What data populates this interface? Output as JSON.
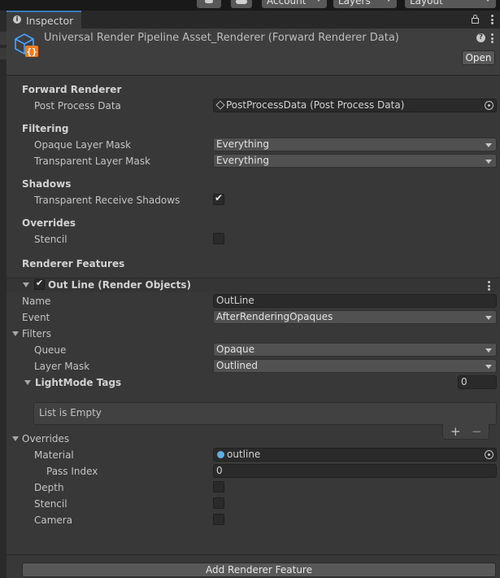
{
  "toolbar": {
    "account": "Account",
    "layers": "Layers",
    "layout": "Layout"
  },
  "tab": {
    "label": "Inspector"
  },
  "header": {
    "title": "Universal Render Pipeline Asset_Renderer (Forward Renderer Data)",
    "open_label": "Open"
  },
  "forward_renderer": {
    "heading": "Forward Renderer",
    "post_process_label": "Post Process Data",
    "post_process_value": "PostProcessData (Post Process Data)"
  },
  "filtering": {
    "heading": "Filtering",
    "opaque_label": "Opaque Layer Mask",
    "opaque_value": "Everything",
    "transparent_label": "Transparent Layer Mask",
    "transparent_value": "Everything"
  },
  "shadows": {
    "heading": "Shadows",
    "receive_label": "Transparent Receive Shadows",
    "receive_checked": true
  },
  "overrides": {
    "heading": "Overrides",
    "stencil_label": "Stencil",
    "stencil_checked": false
  },
  "renderer_features": {
    "heading": "Renderer Features",
    "feature": {
      "title": "Out Line (Render Objects)",
      "enabled": true,
      "name_label": "Name",
      "name_value": "OutLine",
      "event_label": "Event",
      "event_value": "AfterRenderingOpaques",
      "filters_heading": "Filters",
      "queue_label": "Queue",
      "queue_value": "Opaque",
      "layer_mask_label": "Layer Mask",
      "layer_mask_value": "Outlined",
      "lightmode_label": "LightMode Tags",
      "lightmode_count": "0",
      "list_empty": "List is Empty",
      "plus": "+",
      "minus": "−",
      "overrides_heading": "Overrides",
      "material_label": "Material",
      "material_value": "outline",
      "pass_index_label": "Pass Index",
      "pass_index_value": "0",
      "depth_label": "Depth",
      "stencil_label": "Stencil",
      "camera_label": "Camera"
    },
    "add_button": "Add Renderer Feature"
  },
  "colors": {
    "accent_tab": "#3a79bb",
    "panel_bg": "#383838",
    "field_bg": "#2a2a2a",
    "dropdown_bg": "#515151",
    "asset_icon": "#4aa3ff",
    "asset_badge": "#f07c1f"
  }
}
